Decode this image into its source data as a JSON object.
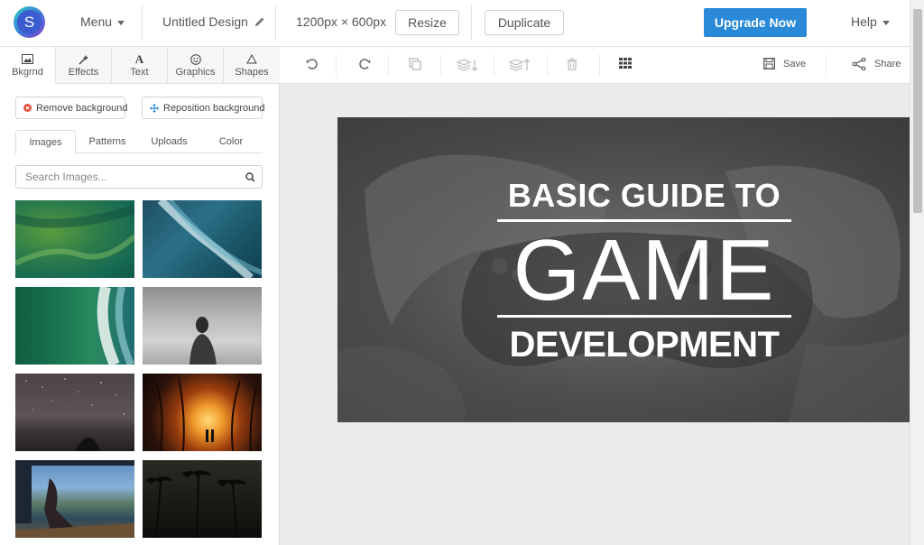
{
  "app": {
    "logo_letter": "S"
  },
  "topbar": {
    "menu_label": "Menu",
    "design_title": "Untitled Design",
    "dimensions": "1200px × 600px",
    "resize_label": "Resize",
    "duplicate_label": "Duplicate",
    "upgrade_label": "Upgrade Now",
    "help_label": "Help",
    "accent_color": "#2a8ad8"
  },
  "tool_tabs": [
    {
      "label": "Bkgrnd",
      "icon": "image-icon"
    },
    {
      "label": "Effects",
      "icon": "wand-icon"
    },
    {
      "label": "Text",
      "icon": "text-icon"
    },
    {
      "label": "Graphics",
      "icon": "smiley-icon"
    },
    {
      "label": "Shapes",
      "icon": "triangle-icon"
    }
  ],
  "background_panel": {
    "remove_label": "Remove background",
    "reposition_label": "Reposition background",
    "subtabs": [
      "Images",
      "Patterns",
      "Uploads",
      "Color"
    ],
    "search_placeholder": "Search Images...",
    "images": [
      "green ocean aerial",
      "blue wave shore aerial",
      "turquoise beach wave aerial",
      "woman on beach black and white",
      "starry night sky over water",
      "steel wool sparks palm trees",
      "person sitting on dock by lake",
      "palm tree silhouettes at night"
    ]
  },
  "editor_toolbar": {
    "save_label": "Save",
    "share_label": "Share"
  },
  "design": {
    "line1": "BASIC GUIDE TO",
    "line2": "GAME",
    "line3": "DEVELOPMENT"
  }
}
